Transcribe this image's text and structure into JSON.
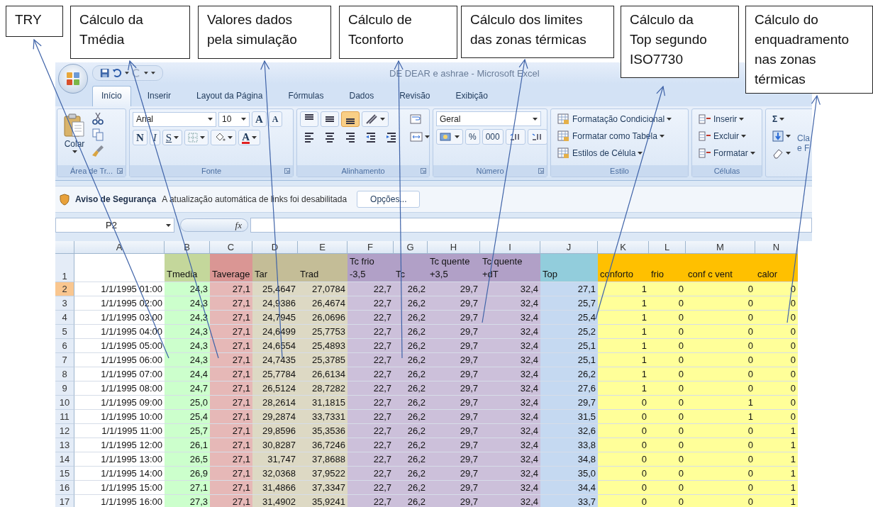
{
  "callouts": [
    {
      "lines": [
        "TRY"
      ]
    },
    {
      "lines": [
        "Cálculo da",
        "Tmédia"
      ]
    },
    {
      "lines": [
        "Valores dados",
        "pela simulação"
      ]
    },
    {
      "lines": [
        "Cálculo de",
        "Tconforto"
      ]
    },
    {
      "lines": [
        "Cálculo dos limites",
        "das zonas térmicas"
      ]
    },
    {
      "lines": [
        "Cálculo da",
        "Top segundo",
        "ISO7730"
      ]
    },
    {
      "lines": [
        "Cálculo do",
        "enquadramento",
        "nas zonas",
        "térmicas"
      ]
    }
  ],
  "window": {
    "title": "DE DEAR e ashrae - Microsoft Excel"
  },
  "tabs": [
    {
      "label": "Início",
      "selected": true
    },
    {
      "label": "Inserir",
      "selected": false
    },
    {
      "label": "Layout da Página",
      "selected": false
    },
    {
      "label": "Fórmulas",
      "selected": false
    },
    {
      "label": "Dados",
      "selected": false
    },
    {
      "label": "Revisão",
      "selected": false
    },
    {
      "label": "Exibição",
      "selected": false
    }
  ],
  "ribbon": {
    "clipboard": {
      "paste": "Colar",
      "label": "Área de Tr..."
    },
    "font": {
      "name": "Arial",
      "size": "10",
      "grow": "A",
      "shrink": "A",
      "bold": "N",
      "italic": "I",
      "underline": "S",
      "color_button": "A",
      "label": "Fonte"
    },
    "alignment": {
      "vertical": [
        {
          "selected": false
        },
        {
          "selected": false
        },
        {
          "selected": true
        }
      ],
      "label": "Alinhamento"
    },
    "number": {
      "format": "Geral",
      "percent": "%",
      "thousands": "000",
      "label": "Número"
    },
    "styles": {
      "items": [
        "Formatação Condicional",
        "Formatar como Tabela",
        "Estilos de Célula"
      ],
      "label": "Estilo"
    },
    "cells": {
      "items": [
        "Inserir",
        "Excluir",
        "Formatar"
      ],
      "label": "Células"
    },
    "editing": {
      "sum": "Σ",
      "cut_text": [
        "Cla",
        "e F"
      ]
    }
  },
  "security_bar": {
    "title": "Aviso de Segurança",
    "message": "A atualização automática de links foi desabilitada",
    "button": "Opções..."
  },
  "formula_bar": {
    "name_box": "P2",
    "fx": "fx"
  },
  "sheet": {
    "columns": [
      {
        "letter": "A"
      },
      {
        "letter": "B",
        "header": {
          "lines": [
            "Tmedia"
          ],
          "color": "#c4d79b"
        },
        "color": "#ccffcc"
      },
      {
        "letter": "C",
        "header": {
          "lines": [
            "Taverage"
          ],
          "color": "#da9694"
        },
        "color": "#e6b8b7"
      },
      {
        "letter": "D",
        "header": {
          "lines": [
            "Tar"
          ],
          "color": "#c4bd97"
        },
        "color": "#ddd9c4"
      },
      {
        "letter": "E",
        "header": {
          "lines": [
            "Trad"
          ],
          "color": "#c4bd97"
        },
        "color": "#ddd9c4"
      },
      {
        "letter": "F",
        "header": {
          "lines": [
            "Tc frio",
            "-3,5"
          ],
          "color": "#b1a0c7"
        },
        "color": "#ccc0da"
      },
      {
        "letter": "G",
        "header": {
          "lines": [
            "Tc"
          ],
          "color": "#b1a0c7"
        },
        "color": "#ccc0da"
      },
      {
        "letter": "H",
        "header": {
          "lines": [
            "Tc quente",
            "+3,5"
          ],
          "color": "#b1a0c7"
        },
        "color": "#ccc0da"
      },
      {
        "letter": "I",
        "header": {
          "lines": [
            "Tc quente",
            "+dT"
          ],
          "color": "#b1a0c7"
        },
        "color": "#ccc0da"
      },
      {
        "letter": "J",
        "header": {
          "lines": [
            "Top"
          ],
          "color": "#92cddc"
        },
        "color": "#c5d9f1"
      },
      {
        "letter": "K",
        "header": {
          "lines": [
            "conforto"
          ],
          "color": "#ffc000"
        },
        "color": "#ffff99"
      },
      {
        "letter": "L",
        "header": {
          "lines": [
            "frio"
          ],
          "color": "#ffc000"
        },
        "color": "#ffff99"
      },
      {
        "letter": "M",
        "header": {
          "lines": [
            "conf c vent"
          ],
          "color": "#ffc000"
        },
        "color": "#ffff99"
      },
      {
        "letter": "N",
        "header": {
          "lines": [
            "calor"
          ],
          "color": "#ffc000"
        },
        "color": "#ffff99"
      }
    ],
    "header_row_number": "1",
    "rows": [
      {
        "number": "2",
        "selected": true,
        "cells": [
          "1/1/1995 01:00",
          "24,3",
          "27,1",
          "25,4647",
          "27,0784",
          "22,7",
          "26,2",
          "29,7",
          "32,4",
          "27,1",
          "1",
          "0",
          "0",
          "0"
        ]
      },
      {
        "number": "3",
        "selected": false,
        "cells": [
          "1/1/1995 02:00",
          "24,3",
          "27,1",
          "24,9386",
          "26,4674",
          "22,7",
          "26,2",
          "29,7",
          "32,4",
          "25,7",
          "1",
          "0",
          "0",
          "0"
        ]
      },
      {
        "number": "4",
        "selected": false,
        "cells": [
          "1/1/1995 03:00",
          "24,3",
          "27,1",
          "24,7945",
          "26,0696",
          "22,7",
          "26,2",
          "29,7",
          "32,4",
          "25,4",
          "1",
          "0",
          "0",
          "0"
        ]
      },
      {
        "number": "5",
        "selected": false,
        "cells": [
          "1/1/1995 04:00",
          "24,3",
          "27,1",
          "24,6499",
          "25,7753",
          "22,7",
          "26,2",
          "29,7",
          "32,4",
          "25,2",
          "1",
          "0",
          "0",
          "0"
        ]
      },
      {
        "number": "6",
        "selected": false,
        "cells": [
          "1/1/1995 05:00",
          "24,3",
          "27,1",
          "24,6554",
          "25,4893",
          "22,7",
          "26,2",
          "29,7",
          "32,4",
          "25,1",
          "1",
          "0",
          "0",
          "0"
        ]
      },
      {
        "number": "7",
        "selected": false,
        "cells": [
          "1/1/1995 06:00",
          "24,3",
          "27,1",
          "24,7435",
          "25,3785",
          "22,7",
          "26,2",
          "29,7",
          "32,4",
          "25,1",
          "1",
          "0",
          "0",
          "0"
        ]
      },
      {
        "number": "8",
        "selected": false,
        "cells": [
          "1/1/1995 07:00",
          "24,4",
          "27,1",
          "25,7784",
          "26,6134",
          "22,7",
          "26,2",
          "29,7",
          "32,4",
          "26,2",
          "1",
          "0",
          "0",
          "0"
        ]
      },
      {
        "number": "9",
        "selected": false,
        "cells": [
          "1/1/1995 08:00",
          "24,7",
          "27,1",
          "26,5124",
          "28,7282",
          "22,7",
          "26,2",
          "29,7",
          "32,4",
          "27,6",
          "1",
          "0",
          "0",
          "0"
        ]
      },
      {
        "number": "10",
        "selected": false,
        "cells": [
          "1/1/1995 09:00",
          "25,0",
          "27,1",
          "28,2614",
          "31,1815",
          "22,7",
          "26,2",
          "29,7",
          "32,4",
          "29,7",
          "0",
          "0",
          "1",
          "0"
        ]
      },
      {
        "number": "11",
        "selected": false,
        "cells": [
          "1/1/1995 10:00",
          "25,4",
          "27,1",
          "29,2874",
          "33,7331",
          "22,7",
          "26,2",
          "29,7",
          "32,4",
          "31,5",
          "0",
          "0",
          "1",
          "0"
        ]
      },
      {
        "number": "12",
        "selected": false,
        "cells": [
          "1/1/1995 11:00",
          "25,7",
          "27,1",
          "29,8596",
          "35,3536",
          "22,7",
          "26,2",
          "29,7",
          "32,4",
          "32,6",
          "0",
          "0",
          "0",
          "1"
        ]
      },
      {
        "number": "13",
        "selected": false,
        "cells": [
          "1/1/1995 12:00",
          "26,1",
          "27,1",
          "30,8287",
          "36,7246",
          "22,7",
          "26,2",
          "29,7",
          "32,4",
          "33,8",
          "0",
          "0",
          "0",
          "1"
        ]
      },
      {
        "number": "14",
        "selected": false,
        "cells": [
          "1/1/1995 13:00",
          "26,5",
          "27,1",
          "31,747",
          "37,8688",
          "22,7",
          "26,2",
          "29,7",
          "32,4",
          "34,8",
          "0",
          "0",
          "0",
          "1"
        ]
      },
      {
        "number": "15",
        "selected": false,
        "cells": [
          "1/1/1995 14:00",
          "26,9",
          "27,1",
          "32,0368",
          "37,9522",
          "22,7",
          "26,2",
          "29,7",
          "32,4",
          "35,0",
          "0",
          "0",
          "0",
          "1"
        ]
      },
      {
        "number": "16",
        "selected": false,
        "cells": [
          "1/1/1995 15:00",
          "27,1",
          "27,1",
          "31,4866",
          "37,3347",
          "22,7",
          "26,2",
          "29,7",
          "32,4",
          "34,4",
          "0",
          "0",
          "0",
          "1"
        ]
      },
      {
        "number": "17",
        "selected": false,
        "cells": [
          "1/1/1995 16:00",
          "27,3",
          "27,1",
          "31,4902",
          "35,9241",
          "22,7",
          "26,2",
          "29,7",
          "32,4",
          "33,7",
          "0",
          "0",
          "0",
          "1"
        ]
      }
    ]
  }
}
